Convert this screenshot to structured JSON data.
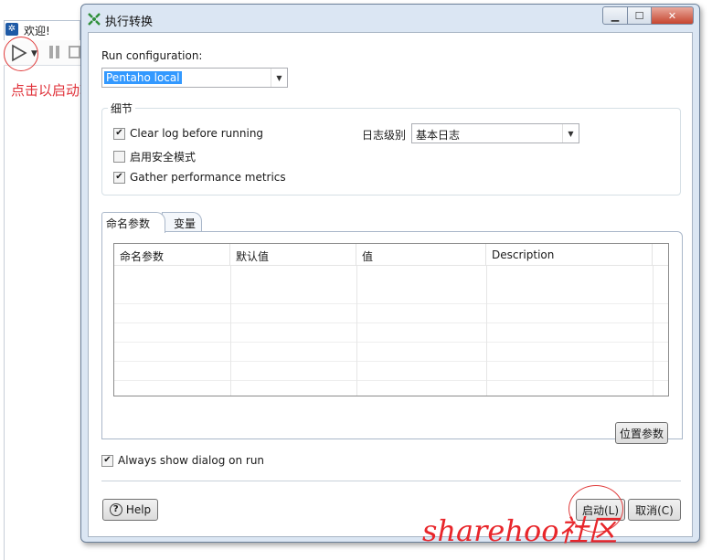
{
  "background": {
    "tab_label": "欢迎!",
    "hint_text": "点击以启动转换"
  },
  "dialog": {
    "title": "执行转换",
    "run_configuration_label": "Run configuration:",
    "run_configuration_value": "Pentaho local",
    "details_legend": "细节",
    "clear_log_label": "Clear log before running",
    "clear_log_checked": true,
    "safe_mode_label": "启用安全模式",
    "safe_mode_checked": false,
    "gather_metrics_label": "Gather performance metrics",
    "gather_metrics_checked": true,
    "log_level_label": "日志级别",
    "log_level_value": "基本日志",
    "tabs": [
      {
        "label": "命名参数",
        "active": true
      },
      {
        "label": "变量",
        "active": false
      }
    ],
    "table_headers": [
      "命名参数",
      "默认值",
      "值",
      "Description"
    ],
    "position_params_button": "位置参数",
    "always_show_label": "Always show dialog on run",
    "always_show_checked": true,
    "help_button": "Help",
    "launch_button": "启动(L)",
    "cancel_button": "取消(C)"
  },
  "watermark": "sharehoo社区",
  "colors": {
    "annotation_red": "#e0323a",
    "dialog_frame": "#dbe6f3",
    "selection_blue": "#3399ff"
  }
}
